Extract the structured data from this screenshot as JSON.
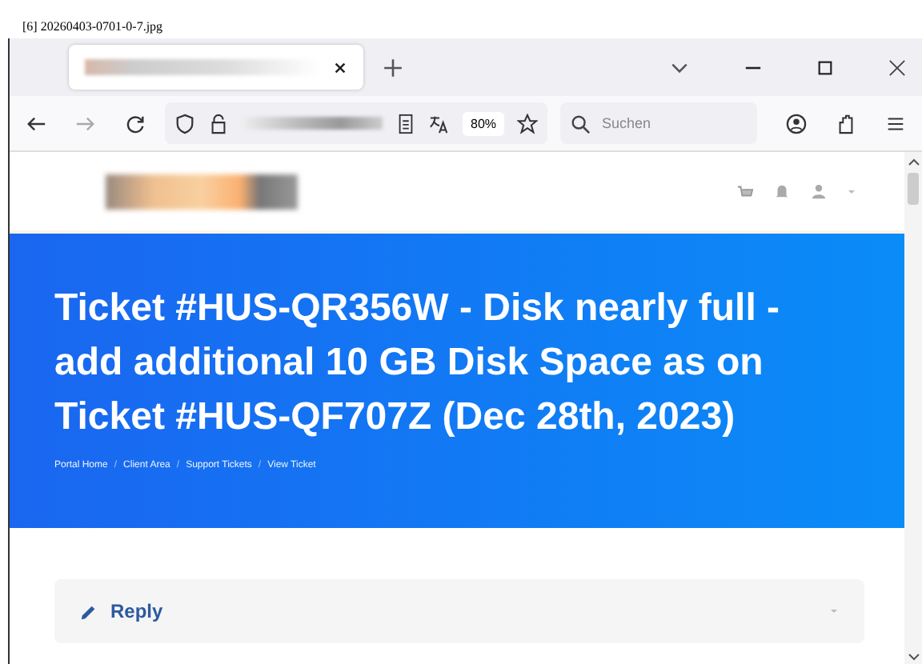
{
  "caption": "[6] 20260403-0701-0-7.jpg",
  "tabs": [
    {
      "selected": true
    }
  ],
  "toolbar": {
    "zoom": "80%",
    "search": {
      "placeholder": "Suchen"
    }
  },
  "hero": {
    "title": "Ticket #HUS-QR356W - Disk nearly full - add additional 10 GB Disk Space as on Ticket #HUS-QF707Z (Dec 28th, 2023)",
    "breadcrumb": [
      {
        "kind": "link",
        "text": "Portal Home"
      },
      {
        "kind": "separator",
        "text": "/"
      },
      {
        "kind": "link",
        "text": "Client Area"
      },
      {
        "kind": "separator",
        "text": "/"
      },
      {
        "kind": "link",
        "text": "Support Tickets"
      },
      {
        "kind": "separator",
        "text": "/"
      },
      {
        "kind": "link",
        "text": "View Ticket"
      }
    ]
  },
  "reply_panel": {
    "label": "Reply",
    "expanded": false
  }
}
